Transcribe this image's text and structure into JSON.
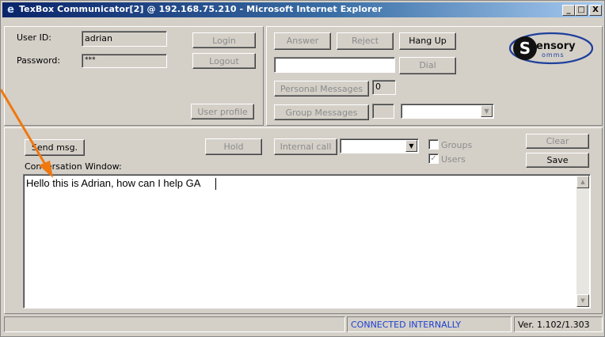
{
  "window": {
    "title": "TexBox Communicator[2] @ 192.168.75.210 - Microsoft Internet Explorer",
    "minimize": "_",
    "maximize": "□",
    "close": "X"
  },
  "login": {
    "user_id_label": "User ID:",
    "user_id_value": "adrian",
    "password_label": "Password:",
    "password_value": "***",
    "login_button": "Login",
    "logout_button": "Logout",
    "user_profile_button": "User profile"
  },
  "call": {
    "answer_button": "Answer",
    "reject_button": "Reject",
    "hang_up_button": "Hang Up",
    "dial_value": "",
    "dial_button": "Dial",
    "personal_messages_button": "Personal Messages",
    "personal_messages_count": "0",
    "group_messages_button": "Group Messages",
    "group_messages_count": "",
    "group_select_value": ""
  },
  "logo": {
    "letter": "S",
    "line1": "ensory",
    "line2": "omms",
    "colors": {
      "blue": "#1f3f9c",
      "dark": "#111111"
    }
  },
  "conversation": {
    "send_msg_button": "Send msg.",
    "hold_button": "Hold",
    "internal_call_button": "Internal call",
    "internal_call_select": "",
    "groups_label": "Groups",
    "groups_checked": false,
    "users_label": "Users",
    "users_checked": true,
    "clear_button": "Clear",
    "save_button": "Save",
    "window_label": "Conversation Window:",
    "text": "Hello this is Adrian, how can I help GA"
  },
  "status_bar": {
    "left": "",
    "connection": "CONNECTED INTERNALLY",
    "version": "Ver. 1.102/1.303",
    "connection_color": "#1c3fd0"
  },
  "annotation": {
    "arrow_color": "#f07810"
  }
}
